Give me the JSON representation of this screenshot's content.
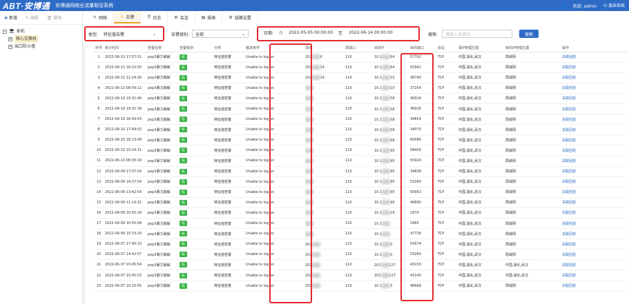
{
  "app": {
    "logo": "ABT·安博通",
    "name": "安博通网络全流量取证系统",
    "welcome": "欢迎: admin",
    "logout": "退出系统"
  },
  "left_toolbar": {
    "add": "新增",
    "edit": "编辑",
    "delete": "删除"
  },
  "tree": {
    "root": "本机",
    "children": [
      "核心交换机",
      "出口防火墙"
    ]
  },
  "tabs": [
    "网络",
    "告警",
    "日志",
    "会话",
    "报表",
    "链路设置"
  ],
  "filters": {
    "type_label": "类型:",
    "type_value": "特征值告警",
    "level_label": "告警级别:",
    "level_value": "全部",
    "date_label": "日期:",
    "date_from": "2022-05-05 00:00:00",
    "date_to_label": "至",
    "date_to": "2022-06-14 00:00:00",
    "search_label": "搜索:",
    "search_placeholder": "请输入关键词",
    "search_button": "搜索"
  },
  "columns": [
    "序号",
    "统计时间",
    "告警名称",
    "告警级别",
    "分类",
    "触发条件",
    "源IP",
    "源端口",
    "目的IP",
    "目的端口",
    "协议",
    "源IP地理位置",
    "目的IP地理位置",
    "操作"
  ],
  "rows": [
    [
      "1",
      "2022-06-13 17:57:51",
      "pop3暴力破解",
      "低",
      "特征值告警",
      "Unable to log on",
      "202",
      "4",
      "110",
      "10.1",
      "64",
      "57702",
      "TCP",
      "中国,湖北,武汉",
      "局域网",
      "关联回放"
    ],
    [
      "2",
      "2022-06-13 16:22:50",
      "pop3暴力破解",
      "低",
      "特征值告警",
      "Unable to log on",
      "202",
      "14",
      "110",
      "10.1",
      "64",
      "55942",
      "TCP",
      "中国,湖北,武汉",
      "局域网",
      "关联回放"
    ],
    [
      "3",
      "2022-06-13 11:24:26",
      "pop3暴力破解",
      "低",
      "特征值告警",
      "Unable to log on",
      "202",
      "14",
      "110",
      "10.1",
      "10",
      "38790",
      "TCP",
      "中国,湖北,武汉",
      "局域网",
      "关联回放"
    ],
    [
      "4",
      "2022-06-13 08:59:12",
      "pop3暴力破解",
      "低",
      "特征值告警",
      "Unable to log on",
      "",
      "",
      "110",
      "10.1",
      "10",
      "37254",
      "TCP",
      "中国,湖北,武汉",
      "局域网",
      "关联回放"
    ],
    [
      "5",
      "2022-06-10 19:31:49",
      "pop3暴力破解",
      "低",
      "特征值告警",
      "Unable to log on",
      "",
      "",
      "110",
      "10.1",
      "58",
      "36918",
      "TCP",
      "中国,湖北,武汉",
      "局域网",
      "关联回放"
    ],
    [
      "6",
      "2022-06-10 19:31:39",
      "pop3暴力破解",
      "低",
      "特征值告警",
      "Unable to log on",
      "",
      "",
      "110",
      "10.1",
      "58",
      "36916",
      "TCP",
      "中国,湖北,武汉",
      "局域网",
      "关联回放"
    ],
    [
      "7",
      "2022-06-10 18:49:43",
      "pop3暴力破解",
      "低",
      "特征值告警",
      "Unable to log on",
      "",
      "",
      "110",
      "10.1",
      "58",
      "34654",
      "TCP",
      "中国,湖北,武汉",
      "局域网",
      "关联回放"
    ],
    [
      "8",
      "2022-06-10 17:49:02",
      "pop3暴力破解",
      "低",
      "特征值告警",
      "Unable to log on",
      "",
      "",
      "110",
      "10.1",
      "58",
      "34070",
      "TCP",
      "中国,湖北,武汉",
      "局域网",
      "关联回放"
    ],
    [
      "9",
      "2022-06-10 16:13:49",
      "pop3暴力破解",
      "低",
      "特征值告警",
      "Unable to log on",
      "",
      "",
      "110",
      "10.1",
      "68",
      "60086",
      "TCP",
      "中国,湖北,武汉",
      "局域网",
      "关联回放"
    ],
    [
      "10",
      "2022-06-10 10:24:31",
      "pop3暴力破解",
      "低",
      "特征值告警",
      "Unable to log on",
      "",
      "",
      "110",
      "10.1",
      "90",
      "58456",
      "TCP",
      "中国,湖北,武汉",
      "局域网",
      "关联回放"
    ],
    [
      "11",
      "2022-06-10 08:30:10",
      "pop3暴力破解",
      "低",
      "特征值告警",
      "Unable to log on",
      "",
      "",
      "110",
      "10.1",
      "90",
      "55924",
      "TCP",
      "中国,湖北,武汉",
      "局域网",
      "关联回放"
    ],
    [
      "12",
      "2022-06-09 17:07:54",
      "pop3暴力破解",
      "低",
      "特征值告警",
      "Unable to log on",
      "",
      "",
      "110",
      "10.1",
      "90",
      "34838",
      "TCP",
      "中国,湖北,武汉",
      "局域网",
      "关联回放"
    ],
    [
      "13",
      "2022-06-09 14:27:54",
      "pop3暴力破解",
      "低",
      "特征值告警",
      "Unable to log on",
      "",
      "",
      "110",
      "10.1",
      "90",
      "53260",
      "TCP",
      "中国,湖北,武汉",
      "局域网",
      "关联回放"
    ],
    [
      "14",
      "2022-06-09 13:42:54",
      "pop3暴力破解",
      "低",
      "特征值告警",
      "Unable to log on",
      "",
      "",
      "110",
      "10.1",
      "90",
      "50952",
      "TCP",
      "中国,湖北,武汉",
      "局域网",
      "关联回放"
    ],
    [
      "15",
      "2022-06-09 11:14:31",
      "pop3暴力破解",
      "低",
      "特征值告警",
      "Unable to log on",
      "",
      "",
      "110",
      "10.1",
      "90",
      "49690",
      "TCP",
      "中国,湖北,武汉",
      "局域网",
      "关联回放"
    ],
    [
      "16",
      "2022-06-09 10:55:29",
      "pop3暴力破解",
      "低",
      "特征值告警",
      "Unable to log on",
      "",
      "",
      "110",
      "10.1",
      "16",
      "1870",
      "TCP",
      "中国,湖北,武汉",
      "局域网",
      "关联回放"
    ],
    [
      "17",
      "2022-06-09 10:55:09",
      "pop3暴力破解",
      "低",
      "特征值告警",
      "Unable to log on",
      "",
      "",
      "110",
      "10.1",
      "",
      "1865",
      "TCP",
      "中国,湖北,武汉",
      "局域网",
      "关联回放"
    ],
    [
      "18",
      "2022-06-09 10:33:24",
      "pop3暴力破解",
      "低",
      "特征值告警",
      "Unable to log on",
      "",
      "",
      "110",
      "10.1",
      "",
      "47728",
      "TCP",
      "中国,湖北,武汉",
      "局域网",
      "关联回放"
    ],
    [
      "19",
      "2022-06-07 17:40:10",
      "pop3暴力破解",
      "低",
      "特征值告警",
      "Unable to log on",
      "202",
      "",
      "110",
      "10.1",
      "0",
      "54574",
      "TCP",
      "中国,湖北,武汉",
      "局域网",
      "关联回放"
    ],
    [
      "20",
      "2022-06-07 14:42:57",
      "pop3暴力破解",
      "低",
      "特征值告警",
      "Unable to log on",
      "202",
      "",
      "110",
      "10.1",
      "0",
      "53260",
      "TCP",
      "中国,湖北,武汉",
      "局域网",
      "关联回放"
    ],
    [
      "21",
      "2022-06-07 10:45:54",
      "pop3暴力破解",
      "低",
      "特征值告警",
      "Unable to log on",
      "202",
      "",
      "110",
      "202",
      "127",
      "43150",
      "TCP",
      "中国,湖北,武汉",
      "中国,湖北,武汉",
      "关联回放"
    ],
    [
      "22",
      "2022-06-07 10:45:53",
      "pop3暴力破解",
      "低",
      "特征值告警",
      "Unable to log on",
      "202",
      "",
      "110",
      "202",
      "127",
      "43140",
      "TCP",
      "中国,湖北,武汉",
      "中国,湖北,武汉",
      "关联回放"
    ],
    [
      "23",
      "2022-06-07 10:15:55",
      "pop3暴力破解",
      "低",
      "特征值告警",
      "Unable to log on",
      "202",
      "",
      "110",
      "10.1",
      "3",
      "48668",
      "TCP",
      "中国,湖北,武汉",
      "局域网",
      "关联回放"
    ]
  ],
  "colors": {
    "topbar": "#2e6bc6",
    "highlight": "#e3262b",
    "level_badge": "#3bb54a",
    "link": "#2e6bc6"
  }
}
